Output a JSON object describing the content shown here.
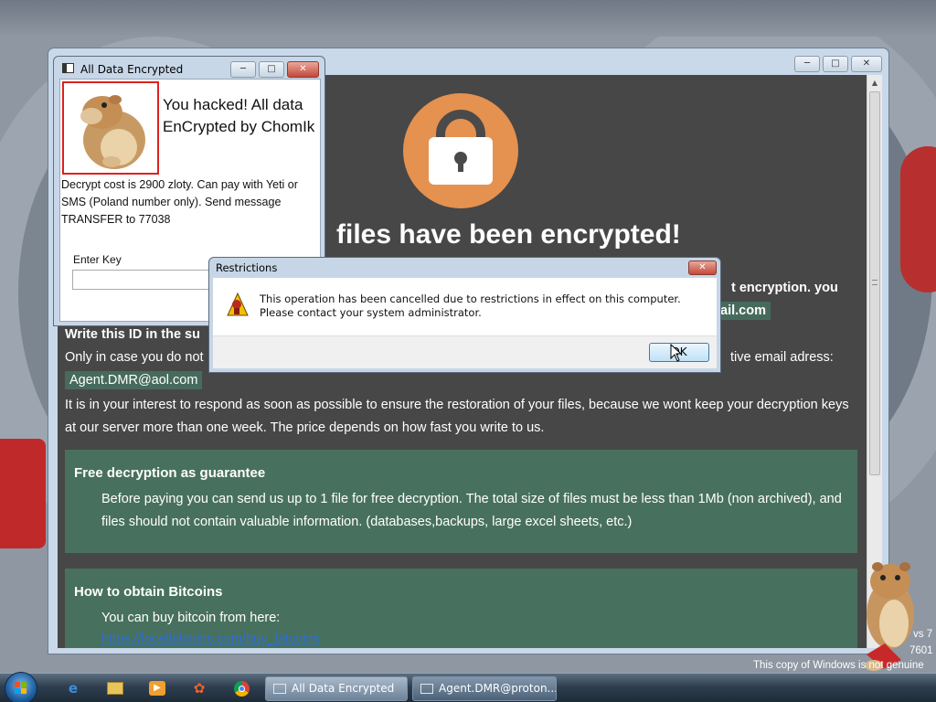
{
  "desktop": {
    "watermark": {
      "line1": "vs 7",
      "line2": "7601",
      "line3": "This copy of Windows is not genuine"
    }
  },
  "ransom_window": {
    "heading": "files have been encrypted!",
    "line_encryption": "t encryption. you",
    "line_email_partial": "ail.com",
    "write_id": "Write this ID in the su",
    "only_case_left": "Only in case you do not",
    "only_case_right": "tive email adress:",
    "alt_email": "Agent.DMR@aol.com",
    "interest_text": "It is in your interest to respond as soon as possible to ensure the restoration of your files, because we wont keep your decryption keys at our server more than one week. The price depends on how fast you write to us.",
    "panel1": {
      "title": "Free decryption as guarantee",
      "body": "Before paying you can send us up to 1 file for free decryption. The total size of files must be less than 1Mb (non archived), and files should not contain valuable information. (databases,backups, large excel sheets, etc.)"
    },
    "panel2": {
      "title": "How to obtain Bitcoins",
      "body": "You can buy bitcoin from here:",
      "link": "https://localbitcoins.com/buy_bitcoins"
    }
  },
  "small_window": {
    "title": "All Data Encrypted",
    "headline": "You hacked! All data EnCrypted by ChomIk",
    "description": "Decrypt cost is 2900 zloty. Can pay with Yeti or SMS (Poland number only). Send message TRANSFER to 77038",
    "key_label": "Enter Key",
    "key_value": ""
  },
  "dialog": {
    "title": "Restrictions",
    "message": "This operation has been cancelled due to restrictions in effect on this computer. Please contact your system administrator.",
    "ok_label": "OK"
  },
  "taskbar": {
    "tasks": [
      {
        "label": "All Data Encrypted",
        "active": true
      },
      {
        "label": "Agent.DMR@proton...",
        "active": false
      }
    ]
  },
  "colors": {
    "ransom_bg": "#474747",
    "lock_orange": "#e5914f",
    "panel_green": "#48705f",
    "dialog_frame": "#c6d6e7"
  }
}
